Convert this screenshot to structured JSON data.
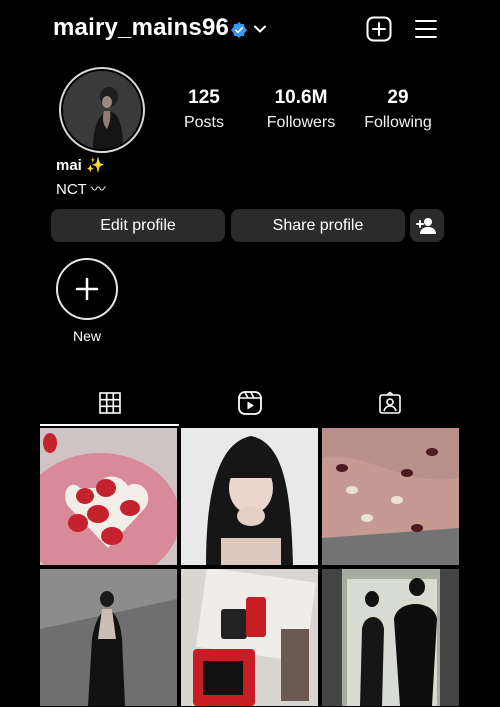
{
  "header": {
    "username": "mairy_mains96",
    "icons": [
      "verified-badge-icon",
      "chevron-down-icon",
      "create-post-icon",
      "menu-icon"
    ]
  },
  "profile": {
    "stats": [
      {
        "value": "125",
        "label": "Posts"
      },
      {
        "value": "10.6M",
        "label": "Followers"
      },
      {
        "value": "29",
        "label": "Following"
      }
    ],
    "bio_name": "mai ✨",
    "bio_line": "NCT 〰"
  },
  "actions": {
    "edit_label": "Edit profile",
    "share_label": "Share profile",
    "add_icon": "add-person-icon"
  },
  "highlights": {
    "new_label": "New"
  },
  "tabs": [
    {
      "icon": "grid-icon",
      "active": true
    },
    {
      "icon": "reels-icon",
      "active": false
    },
    {
      "icon": "tagged-icon",
      "active": false
    }
  ],
  "posts": [
    {
      "subject": "strawberry heart cake"
    },
    {
      "subject": "girl with black hair selfie"
    },
    {
      "subject": "painted nails"
    },
    {
      "subject": "woman in black dress"
    },
    {
      "subject": "perfume bottles and magazine"
    },
    {
      "subject": "couple in black outfits"
    }
  ],
  "colors": {
    "background": "#000000",
    "button_bg": "#2b2b2b",
    "verified": "#3897f0"
  }
}
